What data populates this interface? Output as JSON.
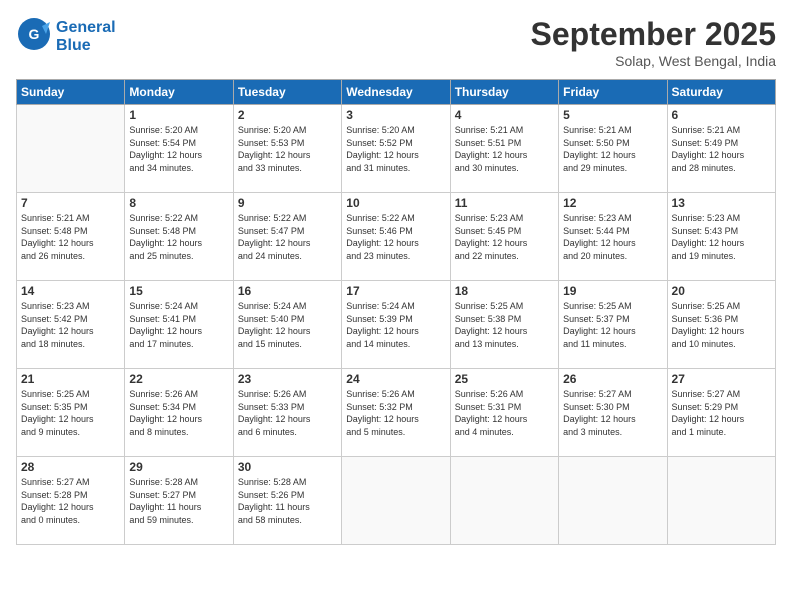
{
  "header": {
    "logo_line1": "General",
    "logo_line2": "Blue",
    "month": "September 2025",
    "location": "Solap, West Bengal, India"
  },
  "days_of_week": [
    "Sunday",
    "Monday",
    "Tuesday",
    "Wednesday",
    "Thursday",
    "Friday",
    "Saturday"
  ],
  "weeks": [
    [
      {
        "day": "",
        "info": ""
      },
      {
        "day": "1",
        "info": "Sunrise: 5:20 AM\nSunset: 5:54 PM\nDaylight: 12 hours\nand 34 minutes."
      },
      {
        "day": "2",
        "info": "Sunrise: 5:20 AM\nSunset: 5:53 PM\nDaylight: 12 hours\nand 33 minutes."
      },
      {
        "day": "3",
        "info": "Sunrise: 5:20 AM\nSunset: 5:52 PM\nDaylight: 12 hours\nand 31 minutes."
      },
      {
        "day": "4",
        "info": "Sunrise: 5:21 AM\nSunset: 5:51 PM\nDaylight: 12 hours\nand 30 minutes."
      },
      {
        "day": "5",
        "info": "Sunrise: 5:21 AM\nSunset: 5:50 PM\nDaylight: 12 hours\nand 29 minutes."
      },
      {
        "day": "6",
        "info": "Sunrise: 5:21 AM\nSunset: 5:49 PM\nDaylight: 12 hours\nand 28 minutes."
      }
    ],
    [
      {
        "day": "7",
        "info": "Sunrise: 5:21 AM\nSunset: 5:48 PM\nDaylight: 12 hours\nand 26 minutes."
      },
      {
        "day": "8",
        "info": "Sunrise: 5:22 AM\nSunset: 5:48 PM\nDaylight: 12 hours\nand 25 minutes."
      },
      {
        "day": "9",
        "info": "Sunrise: 5:22 AM\nSunset: 5:47 PM\nDaylight: 12 hours\nand 24 minutes."
      },
      {
        "day": "10",
        "info": "Sunrise: 5:22 AM\nSunset: 5:46 PM\nDaylight: 12 hours\nand 23 minutes."
      },
      {
        "day": "11",
        "info": "Sunrise: 5:23 AM\nSunset: 5:45 PM\nDaylight: 12 hours\nand 22 minutes."
      },
      {
        "day": "12",
        "info": "Sunrise: 5:23 AM\nSunset: 5:44 PM\nDaylight: 12 hours\nand 20 minutes."
      },
      {
        "day": "13",
        "info": "Sunrise: 5:23 AM\nSunset: 5:43 PM\nDaylight: 12 hours\nand 19 minutes."
      }
    ],
    [
      {
        "day": "14",
        "info": "Sunrise: 5:23 AM\nSunset: 5:42 PM\nDaylight: 12 hours\nand 18 minutes."
      },
      {
        "day": "15",
        "info": "Sunrise: 5:24 AM\nSunset: 5:41 PM\nDaylight: 12 hours\nand 17 minutes."
      },
      {
        "day": "16",
        "info": "Sunrise: 5:24 AM\nSunset: 5:40 PM\nDaylight: 12 hours\nand 15 minutes."
      },
      {
        "day": "17",
        "info": "Sunrise: 5:24 AM\nSunset: 5:39 PM\nDaylight: 12 hours\nand 14 minutes."
      },
      {
        "day": "18",
        "info": "Sunrise: 5:25 AM\nSunset: 5:38 PM\nDaylight: 12 hours\nand 13 minutes."
      },
      {
        "day": "19",
        "info": "Sunrise: 5:25 AM\nSunset: 5:37 PM\nDaylight: 12 hours\nand 11 minutes."
      },
      {
        "day": "20",
        "info": "Sunrise: 5:25 AM\nSunset: 5:36 PM\nDaylight: 12 hours\nand 10 minutes."
      }
    ],
    [
      {
        "day": "21",
        "info": "Sunrise: 5:25 AM\nSunset: 5:35 PM\nDaylight: 12 hours\nand 9 minutes."
      },
      {
        "day": "22",
        "info": "Sunrise: 5:26 AM\nSunset: 5:34 PM\nDaylight: 12 hours\nand 8 minutes."
      },
      {
        "day": "23",
        "info": "Sunrise: 5:26 AM\nSunset: 5:33 PM\nDaylight: 12 hours\nand 6 minutes."
      },
      {
        "day": "24",
        "info": "Sunrise: 5:26 AM\nSunset: 5:32 PM\nDaylight: 12 hours\nand 5 minutes."
      },
      {
        "day": "25",
        "info": "Sunrise: 5:26 AM\nSunset: 5:31 PM\nDaylight: 12 hours\nand 4 minutes."
      },
      {
        "day": "26",
        "info": "Sunrise: 5:27 AM\nSunset: 5:30 PM\nDaylight: 12 hours\nand 3 minutes."
      },
      {
        "day": "27",
        "info": "Sunrise: 5:27 AM\nSunset: 5:29 PM\nDaylight: 12 hours\nand 1 minute."
      }
    ],
    [
      {
        "day": "28",
        "info": "Sunrise: 5:27 AM\nSunset: 5:28 PM\nDaylight: 12 hours\nand 0 minutes."
      },
      {
        "day": "29",
        "info": "Sunrise: 5:28 AM\nSunset: 5:27 PM\nDaylight: 11 hours\nand 59 minutes."
      },
      {
        "day": "30",
        "info": "Sunrise: 5:28 AM\nSunset: 5:26 PM\nDaylight: 11 hours\nand 58 minutes."
      },
      {
        "day": "",
        "info": ""
      },
      {
        "day": "",
        "info": ""
      },
      {
        "day": "",
        "info": ""
      },
      {
        "day": "",
        "info": ""
      }
    ]
  ]
}
